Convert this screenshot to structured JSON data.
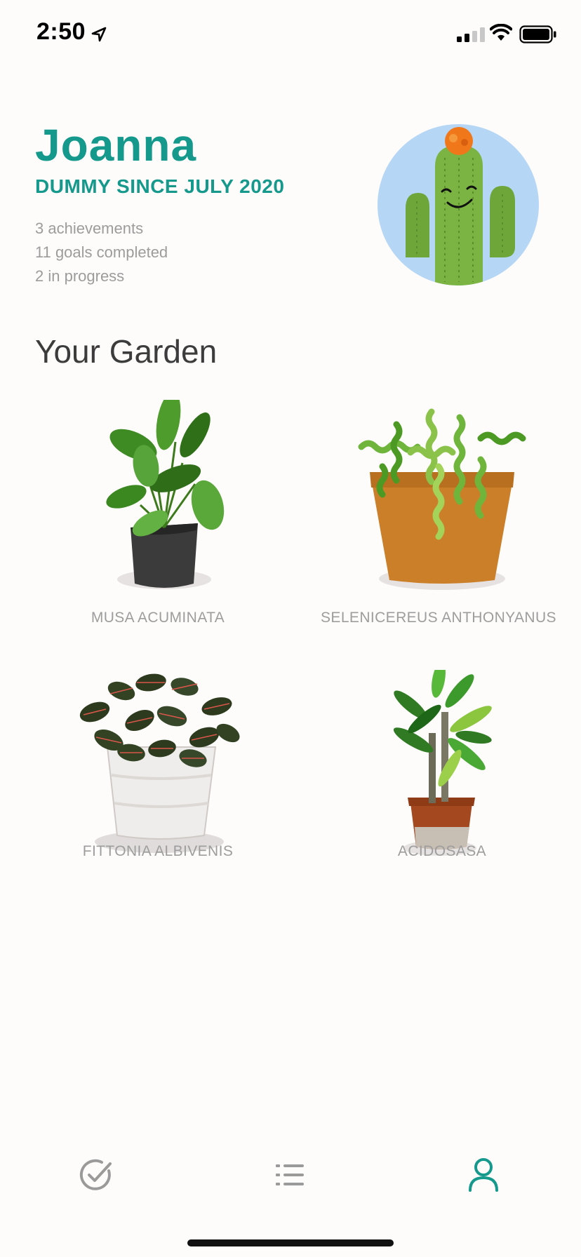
{
  "status_bar": {
    "time": "2:50",
    "icons": [
      "location-arrow-icon",
      "cellular-signal-icon",
      "wifi-icon",
      "battery-icon"
    ]
  },
  "profile": {
    "name": "Joanna",
    "since": "DUMMY SINCE JULY 2020",
    "stats": [
      "3 achievements",
      "11 goals completed",
      "2 in progress"
    ],
    "avatar_icon": "cactus-avatar-icon"
  },
  "garden": {
    "title": "Your Garden",
    "plants": [
      {
        "name": "MUSA ACUMINATA",
        "icon": "banana-plant-black-pot-icon"
      },
      {
        "name": "SELENICEREUS ANTHONYANUS",
        "icon": "curly-fern-terracotta-pot-icon"
      },
      {
        "name": "FITTONIA ALBIVENIS",
        "icon": "fittonia-white-pot-icon"
      },
      {
        "name": "ACIDOSASA",
        "icon": "dracaena-small-pot-icon"
      }
    ]
  },
  "tab_bar": {
    "tabs": [
      {
        "icon": "check-circle-icon",
        "active": false
      },
      {
        "icon": "list-icon",
        "active": false
      },
      {
        "icon": "profile-icon",
        "active": true
      }
    ],
    "active_color": "#14998c",
    "inactive_color": "#9a9a9a"
  },
  "colors": {
    "accent": "#14998c",
    "muted_text": "#9c9c9c",
    "title_text": "#3c3c3c"
  }
}
